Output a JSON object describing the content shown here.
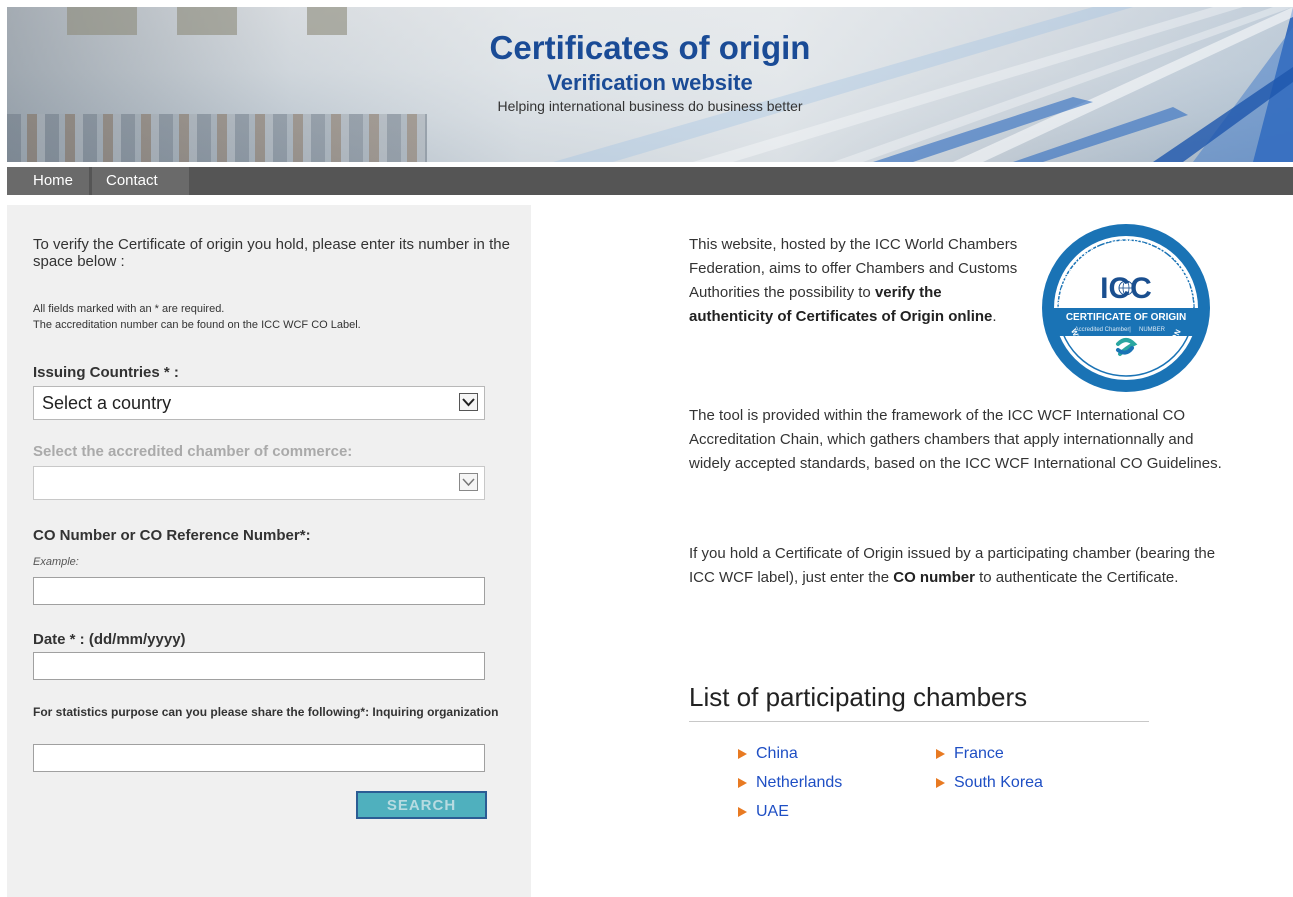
{
  "header": {
    "title": "Certificates of origin",
    "subtitle": "Verification website",
    "tagline": "Helping international business do business better"
  },
  "nav": {
    "items": [
      {
        "label": "Home"
      },
      {
        "label": "Contact"
      }
    ]
  },
  "form": {
    "intro": "To verify the Certificate of origin you hold, please enter its number in the space below :",
    "note_required": "All fields marked with an * are required.",
    "note_accreditation": "The accreditation number can be found on the ICC WCF CO Label.",
    "country_label": "Issuing Countries * :",
    "country_selected": "Select a country",
    "chamber_label": "Select the accredited chamber of commerce:",
    "chamber_selected": "",
    "co_number_label": "CO Number or CO Reference Number*:",
    "co_example": "Example:",
    "co_number_value": "",
    "date_label": "Date * : (dd/mm/yyyy)",
    "date_value": "",
    "stats_label": "For statistics purpose can you please share the following*: Inquiring organization",
    "org_value": "",
    "search_label": "SEARCH"
  },
  "info": {
    "p1_a": "This website, hosted by the ICC World Chambers Federation, aims to offer Chambers and Customs Authorities the possibility to ",
    "p1_b": "verify the authenticity of Certificates of Origin online",
    "p1_c": ".",
    "p2": "The tool is provided within the framework of the ICC WCF International CO Accreditation Chain, which gathers chambers that apply internationnally and widely accepted standards, based on the ICC WCF International CO Guidelines.",
    "p3_a": "If you hold a Certificate of Origin issued by a participating chamber (bearing the ICC WCF label), just enter the ",
    "p3_b": "CO number",
    "p3_c": " to authenticate the Certificate."
  },
  "badge": {
    "top_arc": "INTERNATIONAL CHAMBER OF COMMERCE",
    "logo": "ICC",
    "band_title": "CERTIFICATE OF ORIGIN",
    "band_sub_left": "Accredited Chamber",
    "band_sub_right": "NUMBER",
    "bottom_arc": "WORLD CHAMBERS FEDERATION",
    "color_primary": "#1a73b5",
    "color_accent": "#2aa6a0"
  },
  "chambers": {
    "title": "List of participating chambers",
    "items": [
      "China",
      "France",
      "Netherlands",
      "South Korea",
      "UAE"
    ]
  },
  "colors": {
    "header_blue": "#1a4b96",
    "nav_bg": "#555555",
    "link_blue": "#1f4fc4",
    "bullet_orange": "#e87a22",
    "search_teal": "#4fb0be"
  }
}
